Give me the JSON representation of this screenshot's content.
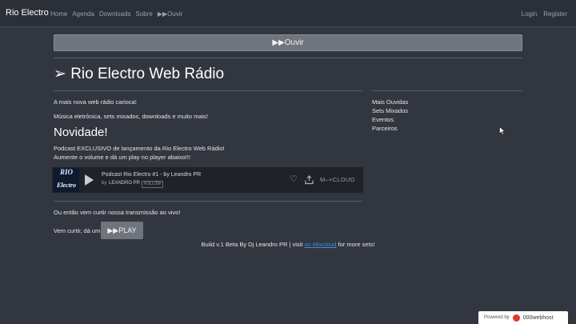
{
  "navbar": {
    "brand": "Rio Electro",
    "links": [
      "Home",
      "Agenda",
      "Downloads",
      "Sobre",
      "▶▶Ouvir"
    ],
    "right_links": [
      "Login",
      "Register"
    ]
  },
  "listen_bar": {
    "label": "▶▶Ouvir"
  },
  "main": {
    "title": "➢ Rio Electro Web Rádio",
    "intro_1": "A mais nova web rádio carioca!",
    "intro_2": "Música eletrônica, sets mixados, downloads e muito mais!",
    "news_title": "Novidade!",
    "news_1": "Podcast EXCLUSIVO de lançamento da Rio Electro Web Rádio!",
    "news_2": "Aumente o volume e dá um play no player abaixo!!!",
    "live_text": "Ou então vem curtir nossa transmissão ao vivo!",
    "play_prompt": "Vem curtir, dá um",
    "play_button": "▶▶PLAY"
  },
  "sidebar": {
    "items": [
      "Mais Ouvidas",
      "Sets Mixados",
      "Eventos",
      "Parceiros"
    ]
  },
  "player": {
    "cover_top": "RIO",
    "cover_bottom": "Electro",
    "track_title": "Podcast Rio Electro #1 - by Leandro PR",
    "by": "by",
    "artist": "LEANDRO PR",
    "follow": "FOLLOW",
    "brand": "M–×CLOUD"
  },
  "footer": {
    "prefix": "Build v.1 Beta By Dj Leandro PR | visit ",
    "link": "on Mixcloud",
    "suffix": " for more sets!"
  },
  "badge": {
    "powered_by": "Powered by",
    "host": "000webhost"
  },
  "colors": {
    "background": "#32363f",
    "navbar": "#2b2f37",
    "button": "#70757d",
    "link": "#3d8ee0"
  }
}
